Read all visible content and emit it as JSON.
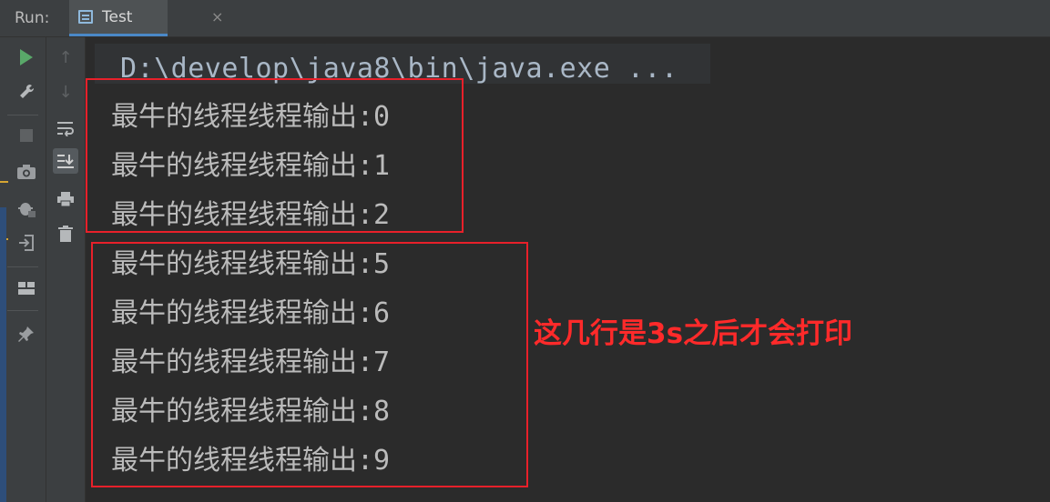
{
  "tabbar": {
    "run_label": "Run:",
    "tab_label": "Test",
    "tab_close": "×"
  },
  "toolbar": {
    "run_icon": "play-icon",
    "wrench_icon": "wrench-icon",
    "stop_icon": "stop-icon",
    "camera_icon": "camera-icon",
    "debug_icon": "bug-icon",
    "login_icon": "enter-icon",
    "layout_icon": "layout-icon",
    "pin_icon": "pin-icon",
    "up_icon": "arrow-up-icon",
    "down_icon": "arrow-down-icon",
    "wrap_icon": "soft-wrap-icon",
    "scroll_icon": "scroll-to-end-icon",
    "print_icon": "printer-icon",
    "trash_icon": "trash-icon"
  },
  "console": {
    "command": "D:\\develop\\java8\\bin\\java.exe ...",
    "lines": [
      "最牛的线程线程输出:0",
      "最牛的线程线程输出:1",
      "最牛的线程线程输出:2",
      "最牛的线程线程输出:5",
      "最牛的线程线程输出:6",
      "最牛的线程线程输出:7",
      "最牛的线程线程输出:8",
      "最牛的线程线程输出:9"
    ],
    "annotation": "这几行是3s之后才会打印"
  },
  "colors": {
    "highlight": "#e8202a",
    "annotation": "#ff2a2a",
    "run_green": "#59a869",
    "tab_underline": "#4a88c7"
  }
}
